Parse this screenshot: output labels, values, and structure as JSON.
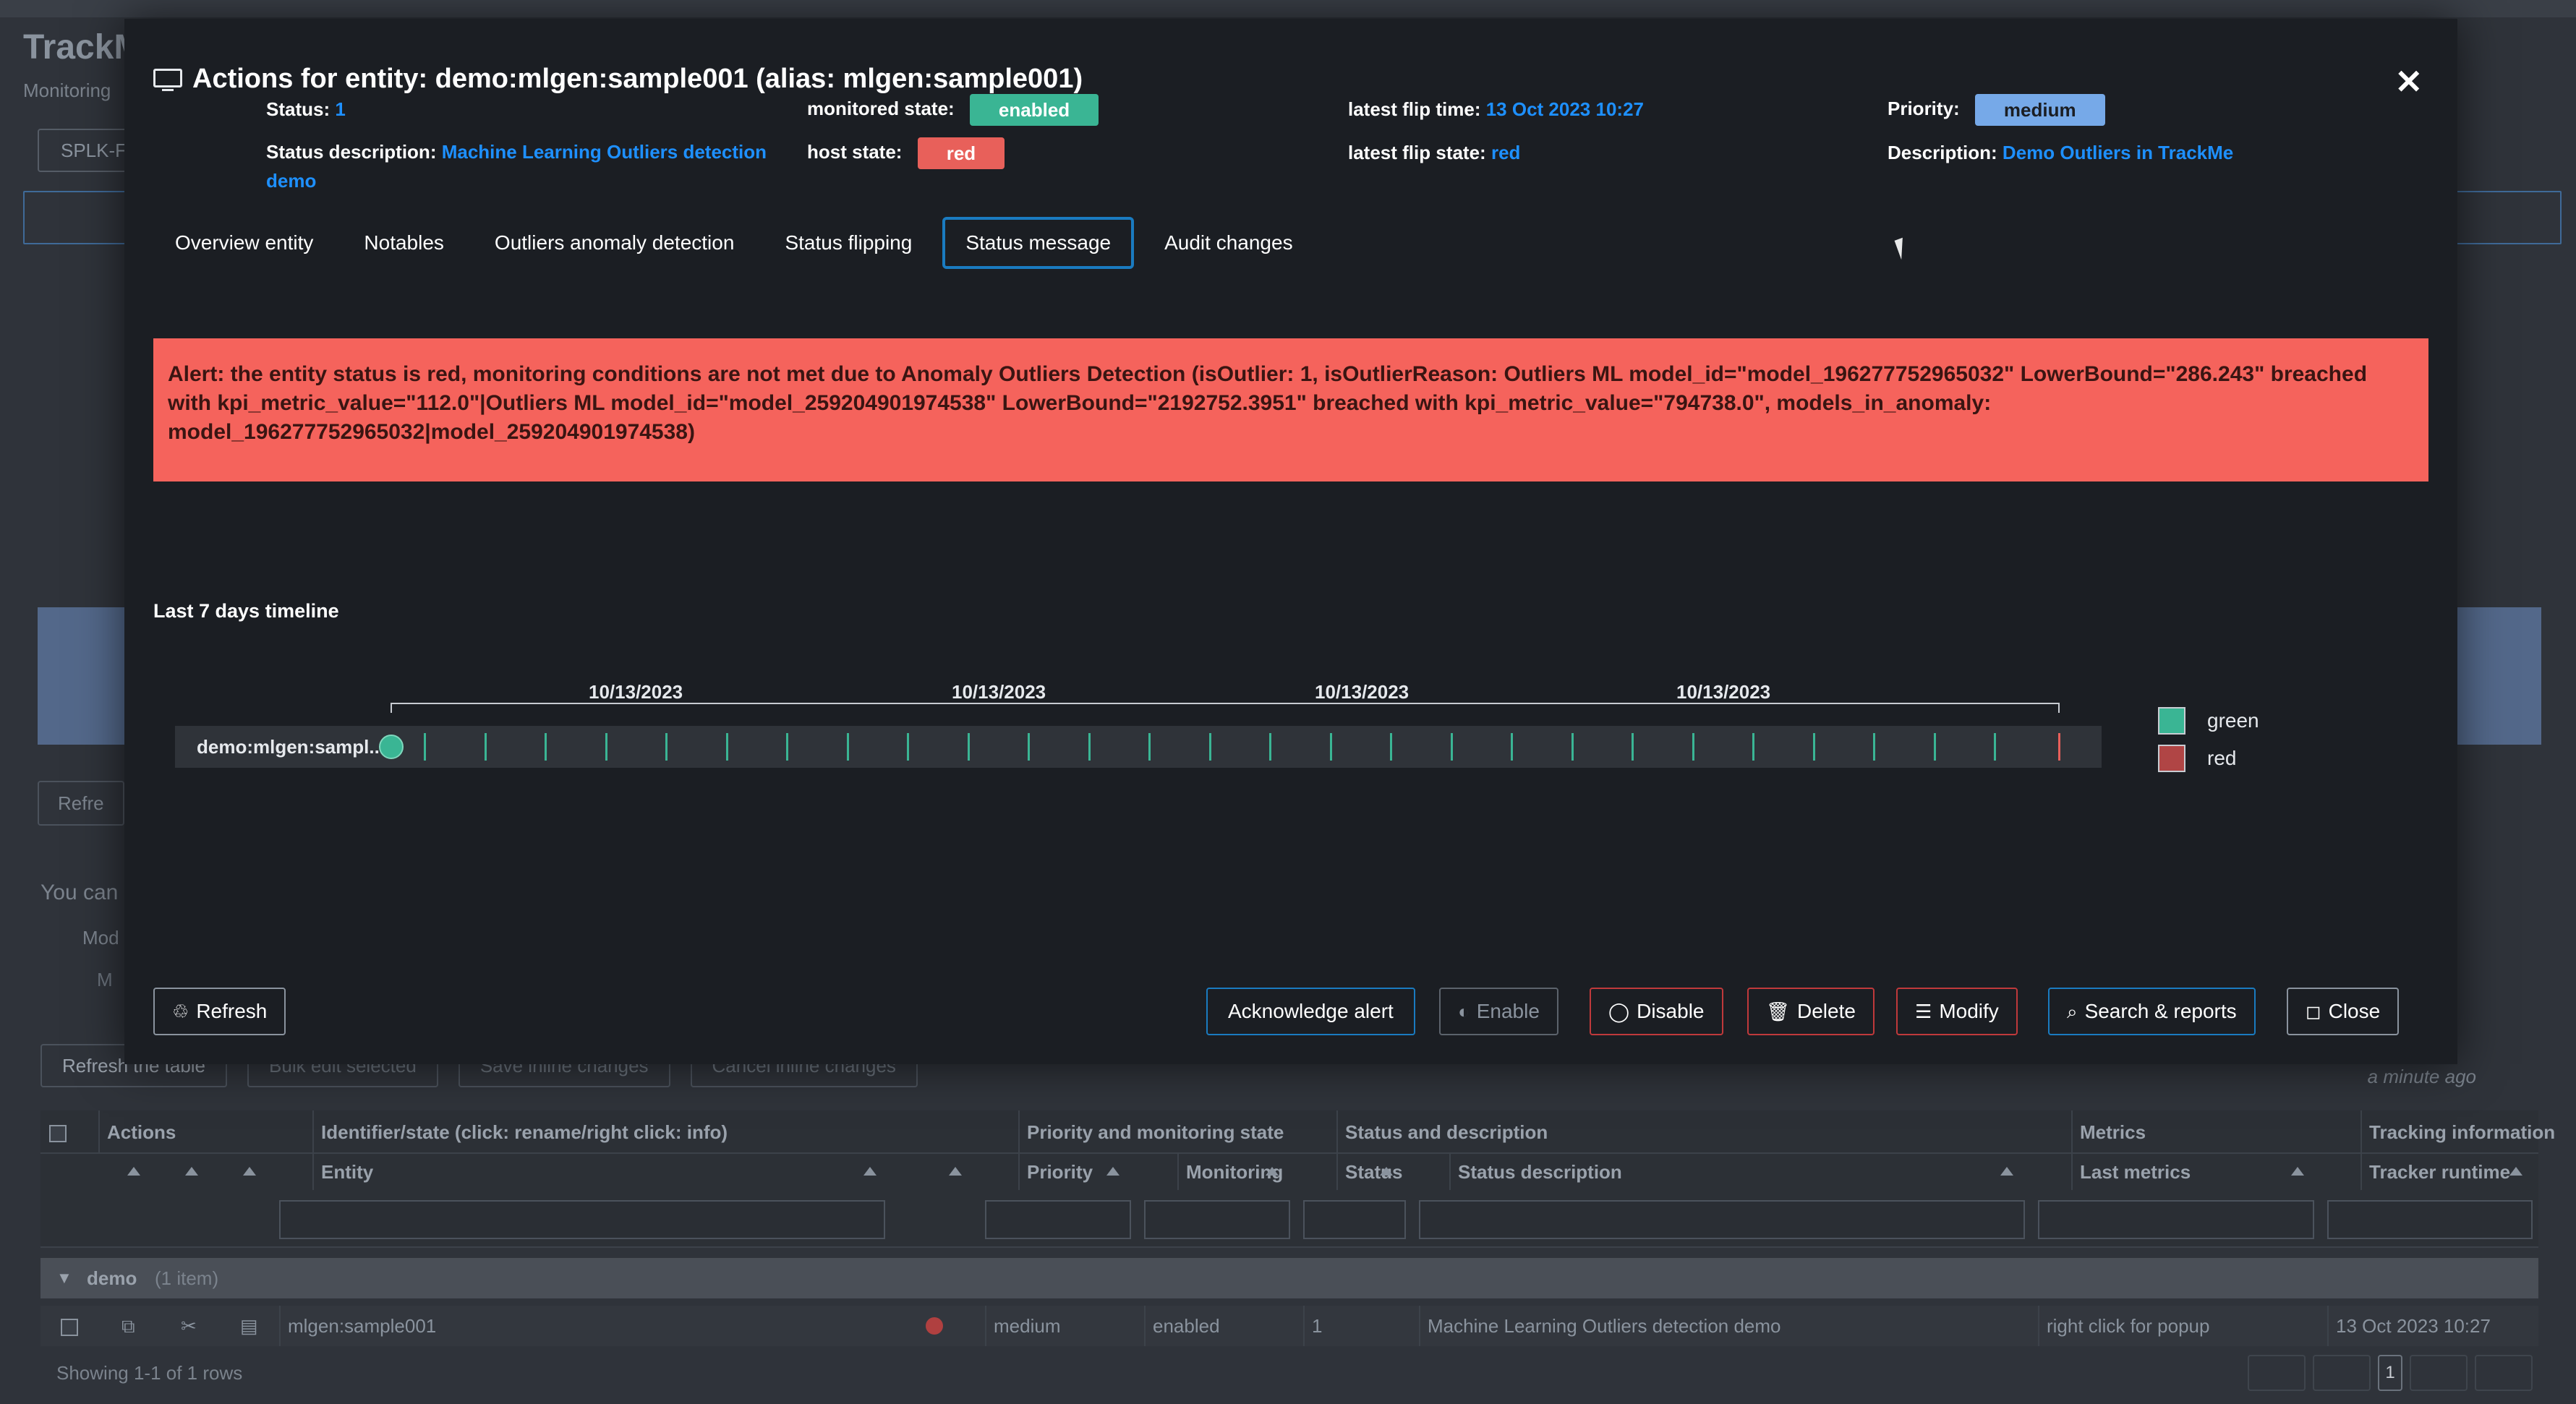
{
  "background": {
    "app_title": "TrackMe",
    "subtitle": "Monitoring",
    "tag": "SPLK-F",
    "refresh_small": "Refre",
    "you_can": "You can",
    "mod_label": "Mod",
    "mod2_label": "M",
    "buttons": [
      "Refresh the table",
      "Bulk edit selected",
      "Save inline changes",
      "Cancel inline changes"
    ],
    "updated": "a minute ago",
    "table": {
      "group_headers": [
        "Actions",
        "Identifier/state (click: rename/right click: info)",
        "Priority and monitoring state",
        "Status and description",
        "Metrics",
        "Tracking information"
      ],
      "column_headers": [
        "Entity",
        "Priority",
        "Monitoring",
        "Status",
        "Status description",
        "Last metrics",
        "Tracker runtime"
      ],
      "group": {
        "name": "demo",
        "count": "(1 item)"
      },
      "row": {
        "entity": "mlgen:sample001",
        "priority": "medium",
        "monitoring": "enabled",
        "status": "1",
        "status_description": "Machine Learning Outliers detection demo",
        "last_metrics": "right click for popup",
        "tracker_runtime": "13 Oct 2023 10:27"
      },
      "showing": "Showing 1-1 of 1 rows",
      "page": "1"
    }
  },
  "modal": {
    "title": "Actions for entity: demo:mlgen:sample001 (alias: mlgen:sample001)",
    "close_glyph": "✕",
    "fields": {
      "status_label": "Status:",
      "status_value": "1",
      "monitored_state_label": "monitored state:",
      "monitored_state_value": "enabled",
      "latest_flip_time_label": "latest flip time:",
      "latest_flip_time_value": "13 Oct 2023 10:27",
      "priority_label": "Priority:",
      "priority_value": "medium",
      "status_description_label": "Status description:",
      "status_description_value": "Machine Learning Outliers detection demo",
      "host_state_label": "host state:",
      "host_state_value": "red",
      "latest_flip_state_label": "latest flip state:",
      "latest_flip_state_value": "red",
      "description_label": "Description:",
      "description_value": "Demo Outliers in TrackMe"
    },
    "tabs": [
      "Overview entity",
      "Notables",
      "Outliers anomaly detection",
      "Status flipping",
      "Status message",
      "Audit changes"
    ],
    "active_tab": "Status message",
    "alert_text": "Alert: the entity status is red, monitoring conditions are not met due to Anomaly Outliers Detection (isOutlier: 1, isOutlierReason: Outliers ML model_id=\"model_196277752965032\" LowerBound=\"286.243\" breached with kpi_metric_value=\"112.0\"|Outliers ML model_id=\"model_259204901974538\" LowerBound=\"2192752.3951\" breached with kpi_metric_value=\"794738.0\", models_in_anomaly: model_196277752965032|model_259204901974538)",
    "timeline": {
      "title": "Last 7 days timeline",
      "lane_label": "demo:mlgen:sampl...",
      "dates": [
        "10/13/2023",
        "10/13/2023",
        "10/13/2023",
        "10/13/2023"
      ],
      "legend": [
        {
          "label": "green",
          "color": "#3ab594"
        },
        {
          "label": "red",
          "color": "#b04545"
        }
      ]
    },
    "buttons": {
      "refresh": "Refresh",
      "acknowledge": "Acknowledge alert",
      "enable": "Enable",
      "disable": "Disable",
      "delete": "Delete",
      "modify": "Modify",
      "search": "Search & reports",
      "close": "Close"
    }
  }
}
